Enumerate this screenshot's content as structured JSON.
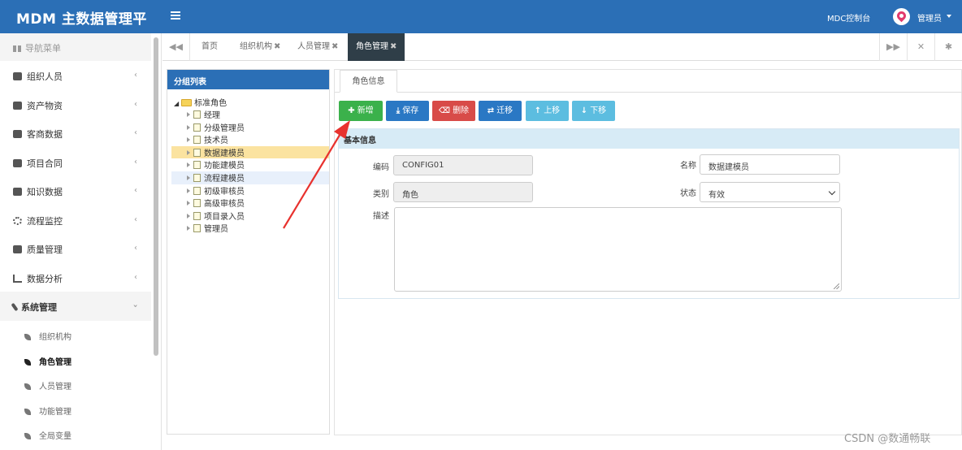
{
  "app": {
    "title": "MDM 主数据管理平",
    "console_link": "MDC控制台",
    "user": "管理员"
  },
  "sidebar": {
    "header": "导航菜单",
    "items": [
      {
        "label": "组织人员"
      },
      {
        "label": "资产物资"
      },
      {
        "label": "客商数据"
      },
      {
        "label": "项目合同"
      },
      {
        "label": "知识数据"
      },
      {
        "label": "流程监控"
      },
      {
        "label": "质量管理"
      },
      {
        "label": "数据分析"
      },
      {
        "label": "系统管理",
        "expanded": true
      }
    ],
    "sub_items": [
      {
        "label": "组织机构"
      },
      {
        "label": "角色管理",
        "active": true
      },
      {
        "label": "人员管理"
      },
      {
        "label": "功能管理"
      },
      {
        "label": "全局变量"
      }
    ]
  },
  "tabs": [
    {
      "label": "首页",
      "closable": false
    },
    {
      "label": "组织机构",
      "closable": true
    },
    {
      "label": "人员管理",
      "closable": true
    },
    {
      "label": "角色管理",
      "closable": true,
      "active": true
    }
  ],
  "group_list": {
    "title": "分组列表",
    "root": "标准角色",
    "nodes": [
      {
        "label": "经理"
      },
      {
        "label": "分级管理员"
      },
      {
        "label": "技术员"
      },
      {
        "label": "数据建模员",
        "selected": true
      },
      {
        "label": "功能建模员"
      },
      {
        "label": "流程建模员",
        "hover": true
      },
      {
        "label": "初级审核员"
      },
      {
        "label": "高级审核员"
      },
      {
        "label": "项目录入员"
      },
      {
        "label": "管理员"
      }
    ]
  },
  "role_info": {
    "tab": "角色信息",
    "toolbar": {
      "add": "新增",
      "save": "保存",
      "delete": "删除",
      "migrate": "迁移",
      "move_up": "上移",
      "move_down": "下移"
    },
    "section_title": "基本信息",
    "fields": {
      "code_label": "编码",
      "code_value": "CONFIG01",
      "name_label": "名称",
      "name_value": "数据建模员",
      "type_label": "类别",
      "type_value": "角色",
      "status_label": "状态",
      "status_value": "有效",
      "desc_label": "描述",
      "desc_value": ""
    }
  },
  "watermark": "CSDN @数通畅联",
  "colors": {
    "header": "#2b6fb6",
    "add": "#3bb14b",
    "save": "#2a78c4",
    "delete": "#d84b48",
    "move": "#5cbde0",
    "annotation_arrow": "#e8322e"
  }
}
